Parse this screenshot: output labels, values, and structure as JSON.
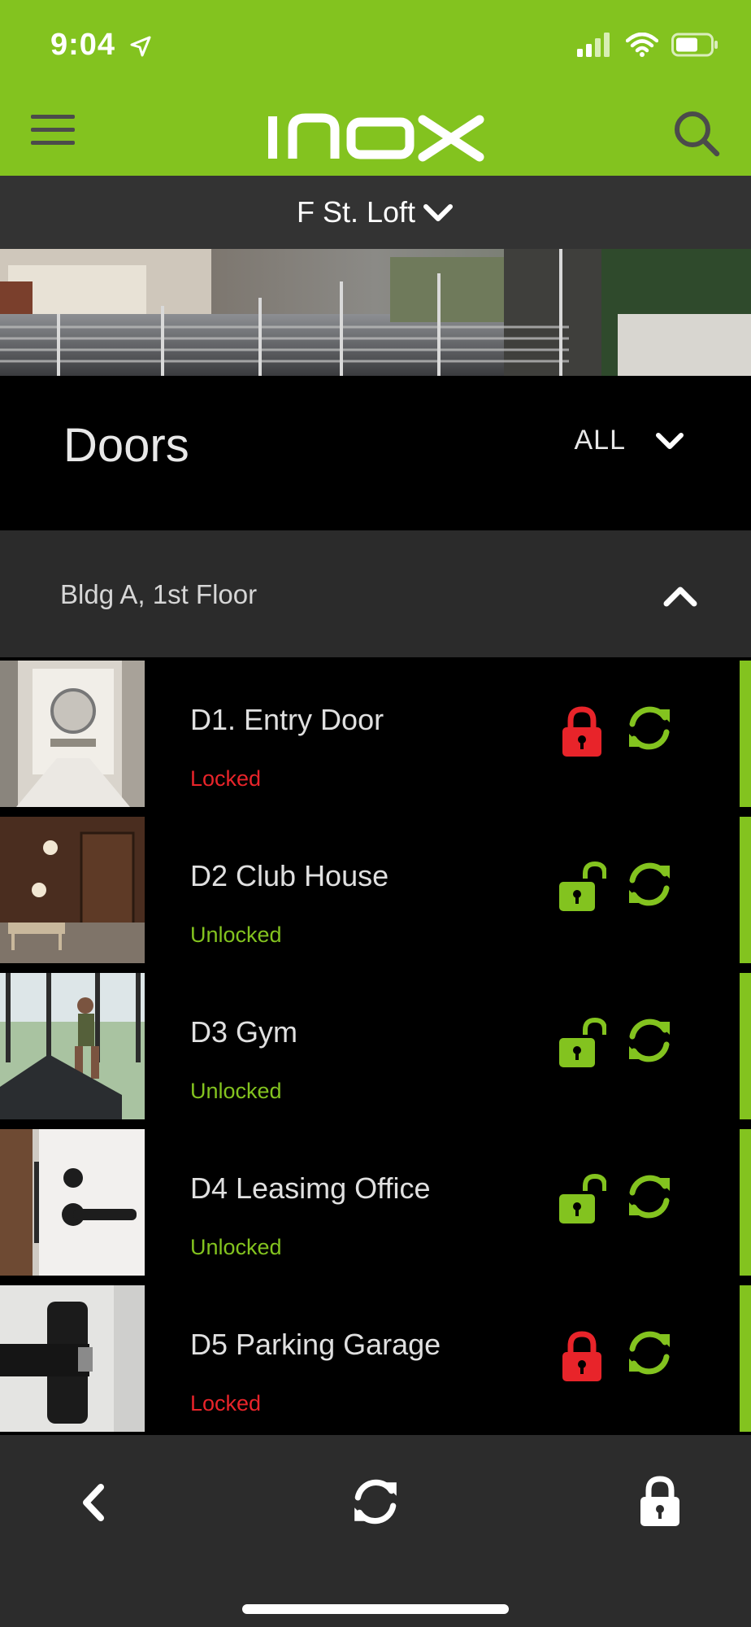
{
  "status_bar": {
    "time": "9:04"
  },
  "header": {
    "logo_text": "inox"
  },
  "location": {
    "name": "F St. Loft"
  },
  "doors_section": {
    "title": "Doors",
    "filter": "ALL"
  },
  "group": {
    "label": "Bldg A, 1st Floor"
  },
  "doors": [
    {
      "name": "D1. Entry Door",
      "status": "Locked"
    },
    {
      "name": "D2 Club House",
      "status": "Unlocked"
    },
    {
      "name": "D3 Gym",
      "status": "Unlocked"
    },
    {
      "name": "D4 Leasimg Office",
      "status": "Unlocked"
    },
    {
      "name": "D5 Parking Garage",
      "status": "Locked"
    }
  ],
  "colors": {
    "brand_green": "#83c31f",
    "locked_red": "#e8242a",
    "unlocked_green": "#83c31f"
  },
  "icons": {
    "menu": "hamburger-icon",
    "search": "search-icon",
    "lock": "lock-icon",
    "unlock": "unlock-icon",
    "sync": "sync-icon",
    "back": "back-chevron-icon"
  }
}
